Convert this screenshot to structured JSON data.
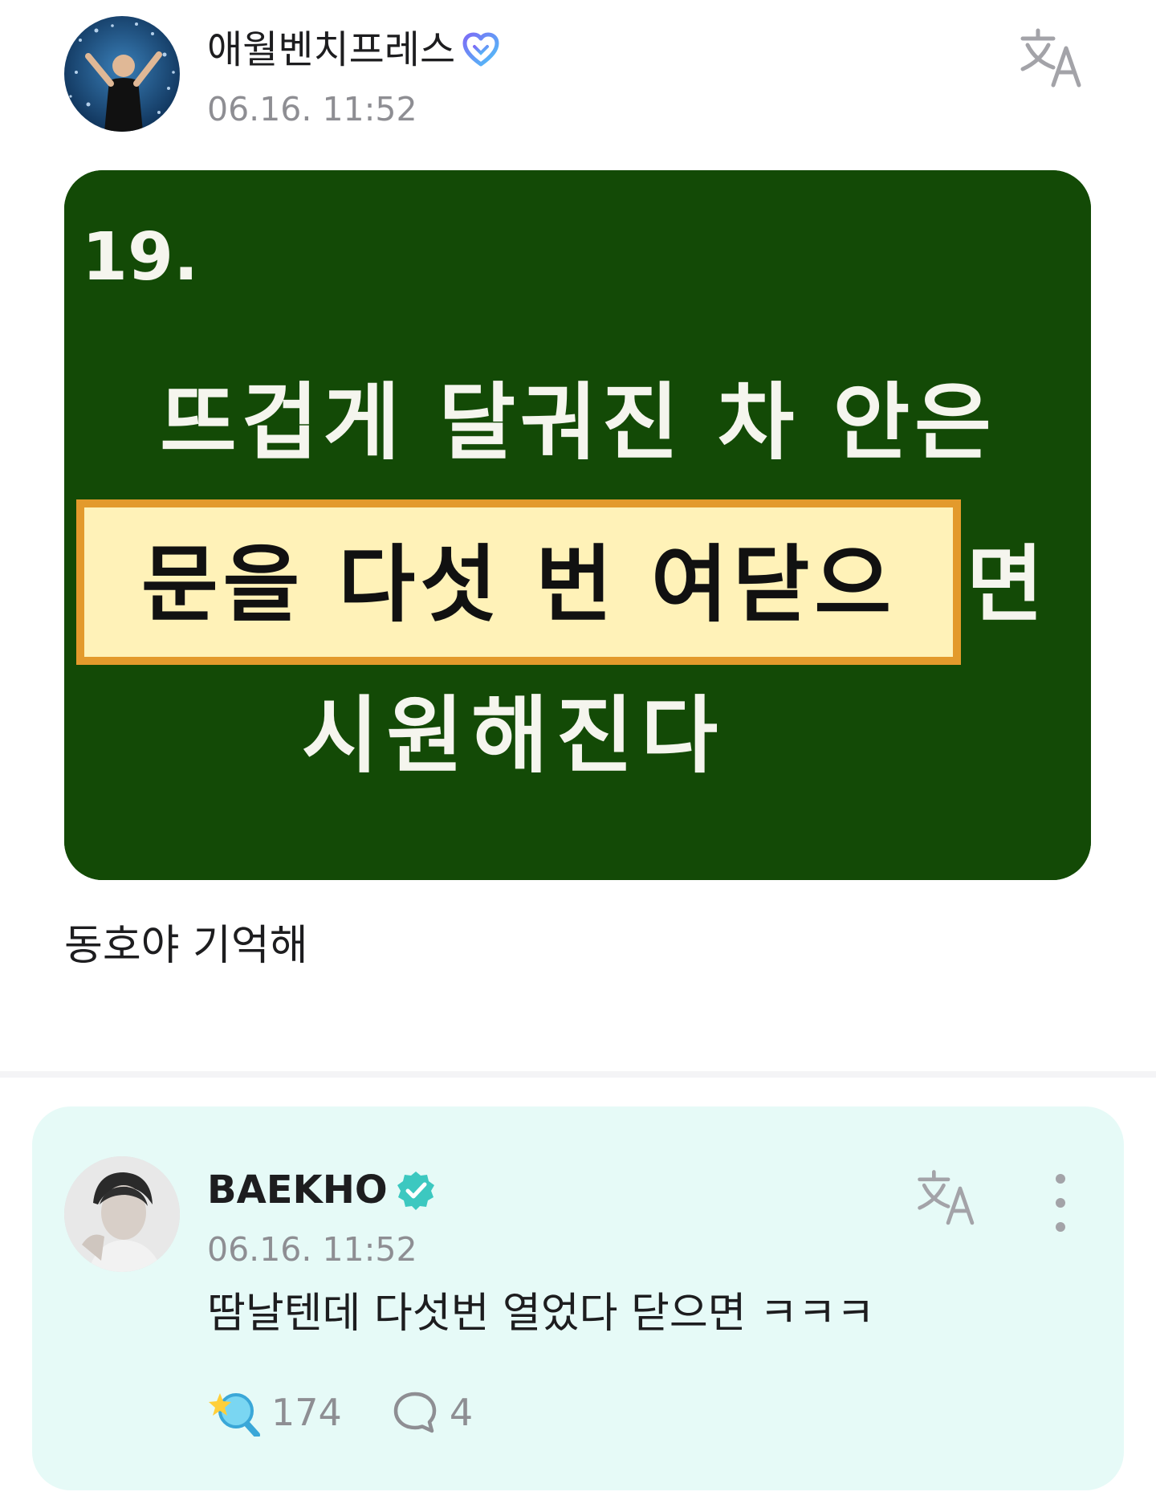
{
  "post": {
    "author": "애월벤치프레스",
    "time": "06.16. 11:52",
    "image_text": {
      "number": "19.",
      "line1": "뜨겁게 달궈진 차 안은",
      "line2_highlight": "문을 다섯 번 여닫으",
      "line2_tail": "면",
      "line3": "시원해진다"
    },
    "body": "동호야 기억해"
  },
  "comment": {
    "author": "BAEKHO",
    "time": "06.16. 11:52",
    "text": "땀날텐데 다섯번 열었다 닫으면 ㅋㅋㅋ",
    "reactions": "174",
    "replies": "4"
  },
  "icons": {
    "translate": "translate-icon",
    "more": "more-vertical-icon",
    "reaction": "light-stick-icon",
    "reply": "speech-bubble-icon",
    "verified": "verified-check-icon",
    "badge": "heart-badge-icon"
  },
  "colors": {
    "comment_bg": "#e6faf7",
    "chalkboard": "#134a06",
    "highlight_fill": "#fff2b8",
    "highlight_border": "#e39a2c",
    "verified": "#3cc8c0",
    "muted": "#8e8e93"
  }
}
